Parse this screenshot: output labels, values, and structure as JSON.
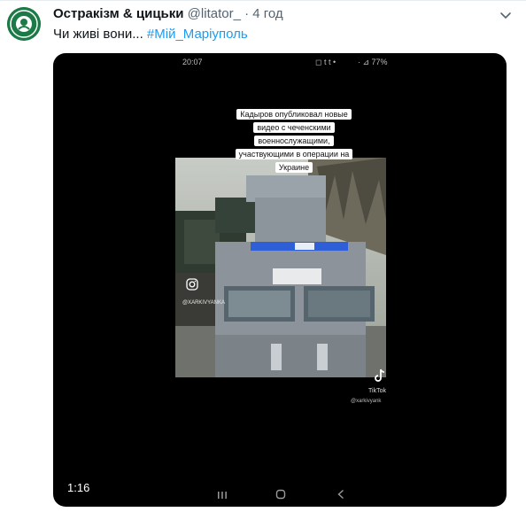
{
  "tweet": {
    "display_name": "Остракізм & цицьки",
    "handle": "@litator_",
    "separator": "·",
    "time": "4 год",
    "text_plain": "Чи живі вони... ",
    "hashtag": "#Мій_Маріуполь"
  },
  "media": {
    "phone_time": "20:07",
    "phone_icons": "◻ t t •",
    "battery": "· ⊿ 77%",
    "caption_lines": [
      "Кадыров опубликовал новые",
      "видео с чеченскими",
      "военнослужащими,",
      "участвующими в операции на",
      "Украине"
    ],
    "instagram_handle": "@XARKIVYANKA",
    "tiktok_label": "TikTok",
    "tiktok_handle": "@xarkivyank",
    "duration": "1:16"
  },
  "colors": {
    "hashtag": "#1d9bf0",
    "text": "#0f1419",
    "secondary": "#536471",
    "media_bg": "#000000"
  },
  "icons": {
    "avatar": "starbucks-style-logo-icon",
    "more": "more-icon",
    "instagram": "instagram-icon",
    "tiktok": "tiktok-icon",
    "nav_recents": "recents-icon",
    "nav_home": "home-icon",
    "nav_back": "back-icon"
  }
}
